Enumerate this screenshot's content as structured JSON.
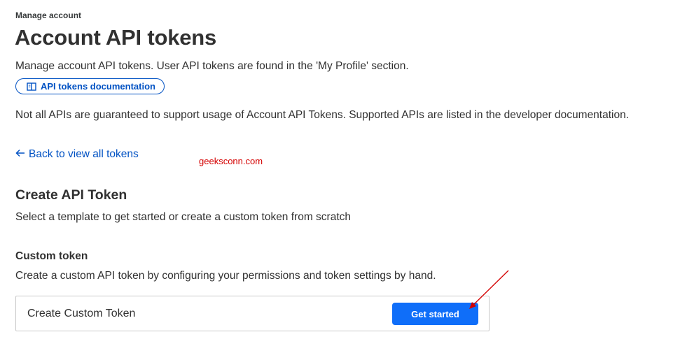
{
  "header": {
    "breadcrumb": "Manage account",
    "title": "Account API tokens",
    "subtitle": "Manage account API tokens. User API tokens are found in the 'My Profile' section.",
    "doc_link_label": "API tokens documentation",
    "doc_link_icon": "book-icon"
  },
  "notice": "Not all APIs are guaranteed to support usage of Account API Tokens. Supported APIs are listed in the developer documentation.",
  "back_link": {
    "label": "Back to view all tokens",
    "icon": "arrow-left-icon"
  },
  "watermark": "geeksconn.com",
  "create_section": {
    "title": "Create API Token",
    "description": "Select a template to get started or create a custom token from scratch"
  },
  "custom_token": {
    "title": "Custom token",
    "description": "Create a custom API token by configuring your permissions and token settings by hand.",
    "card_label": "Create Custom Token",
    "button_label": "Get started"
  },
  "colors": {
    "link": "#0051c3",
    "primary_button": "#0f6ef9",
    "annotation": "#d40000",
    "text": "#313131"
  }
}
